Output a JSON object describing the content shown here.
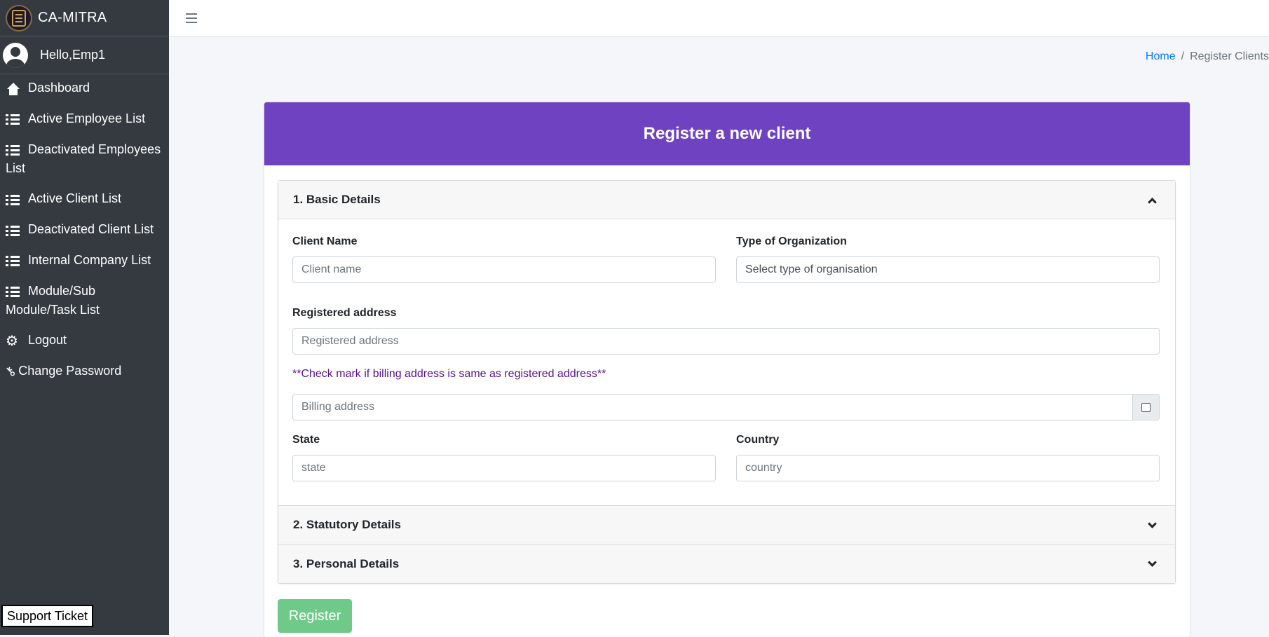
{
  "brand": {
    "title": "CA-MITRA"
  },
  "user": {
    "greeting": "Hello,Emp1"
  },
  "sidebar": {
    "items": [
      {
        "label": "Dashboard",
        "icon": "home-icon"
      },
      {
        "label": "Active Employee List",
        "icon": "list-icon"
      },
      {
        "label": "Deactivated Employees List",
        "icon": "list-icon"
      },
      {
        "label": "Active Client List",
        "icon": "list-icon"
      },
      {
        "label": "Deactivated Client List",
        "icon": "list-icon"
      },
      {
        "label": "Internal Company List",
        "icon": "list-icon"
      },
      {
        "label": "Module/Sub Module/Task List",
        "icon": "list-icon"
      },
      {
        "label": "Logout",
        "icon": "gear-icon"
      },
      {
        "label": "Change Password",
        "icon": "key-icon"
      }
    ],
    "support_label": "Support Ticket"
  },
  "breadcrumb": {
    "home": "Home",
    "separator": "/",
    "current": "Register Clients"
  },
  "form": {
    "title": "Register a new client",
    "sections": [
      {
        "label": "1. Basic Details",
        "expanded": true
      },
      {
        "label": "2. Statutory Details",
        "expanded": false
      },
      {
        "label": "3. Personal Details",
        "expanded": false
      }
    ],
    "client_name": {
      "label": "Client Name",
      "placeholder": "Client name"
    },
    "org_type": {
      "label": "Type of Organization",
      "placeholder": "Select type of organisation"
    },
    "registered_address": {
      "label": "Registered address",
      "placeholder": "Registered address"
    },
    "billing_hint": "**Check mark if billing address is same as registered address**",
    "billing_address": {
      "placeholder": "Billing address",
      "same_as_registered": false
    },
    "state": {
      "label": "State",
      "placeholder": "state"
    },
    "country": {
      "label": "Country",
      "placeholder": "country"
    },
    "register_label": "Register"
  },
  "colors": {
    "sidebar_bg": "#343a40",
    "header_purple": "#6f42c1",
    "register_green": "#6fca8a",
    "link_blue": "#007bff"
  }
}
